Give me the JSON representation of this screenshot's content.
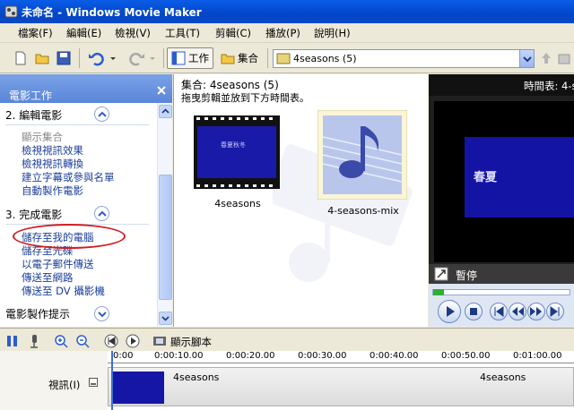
{
  "window": {
    "title": "未命名 - Windows Movie Maker"
  },
  "menu": [
    "檔案(F)",
    "編輯(E)",
    "檢視(V)",
    "工具(T)",
    "剪輯(C)",
    "播放(P)",
    "說明(H)"
  ],
  "toolbar": {
    "tasks_label": "工作",
    "collections_label": "集合",
    "collection_value": "4seasons (5)"
  },
  "taskpane": {
    "header": "電影工作",
    "section2": {
      "title": "2. 編輯電影",
      "items": [
        "顯示集合",
        "檢視視訊效果",
        "檢視視訊轉換",
        "建立字幕或參與名單",
        "自動製作電影"
      ]
    },
    "section3": {
      "title": "3. 完成電影",
      "items": [
        "儲存至我的電腦",
        "儲存至光碟",
        "以電子郵件傳送",
        "傳送至網路",
        "傳送至 DV 攝影機"
      ]
    },
    "tips_title": "電影製作提示"
  },
  "collection": {
    "title": "集合: 4seasons (5)",
    "hint": "拖曳剪輯並放到下方時間表。",
    "clips": [
      {
        "name": "4seasons",
        "thumb_text": "春夏秋冬"
      },
      {
        "name": "4-seasons-mix"
      }
    ]
  },
  "monitor": {
    "title": "時間表: 4-s",
    "screen_text": "春夏",
    "status": "暫停"
  },
  "timeline": {
    "show_storyboard": "顯示腳本",
    "track_label": "視訊(I)",
    "ruler": [
      "0:00",
      "0:00:10.00",
      "0:00:20.00",
      "0:00:30.00",
      "0:00:40.00",
      "0:00:50.00",
      "0:01:00.00"
    ],
    "clips": [
      "4seasons",
      "4seasons"
    ]
  },
  "colors": {
    "titlebar": "#0a5de8",
    "taskpane_header": "#5a86d8",
    "link": "#1b3e9a",
    "highlight": "#d21d1d"
  }
}
